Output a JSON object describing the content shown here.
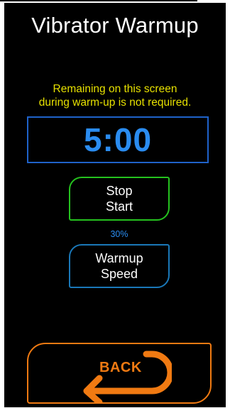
{
  "header": {
    "title": "Vibrator Warmup"
  },
  "notice": {
    "line1": "Remaining on this screen",
    "line2": "during warm-up is not required."
  },
  "timer": {
    "value": "5:00"
  },
  "stop_start_button": {
    "line1": "Stop",
    "line2": "Start"
  },
  "speed": {
    "percent": "30%"
  },
  "warmup_speed_button": {
    "line1": "Warmup",
    "line2": "Speed"
  },
  "back_button": {
    "label": "BACK",
    "icon": "back-arrow-icon"
  },
  "colors": {
    "background": "#000000",
    "title": "#ffffff",
    "notice": "#e6e000",
    "timer_text": "#2a8cf0",
    "timer_border": "#1f62c9",
    "stop_start_border": "#25c21f",
    "warmup_speed_border": "#1a78b8",
    "back_accent": "#f07a12"
  }
}
